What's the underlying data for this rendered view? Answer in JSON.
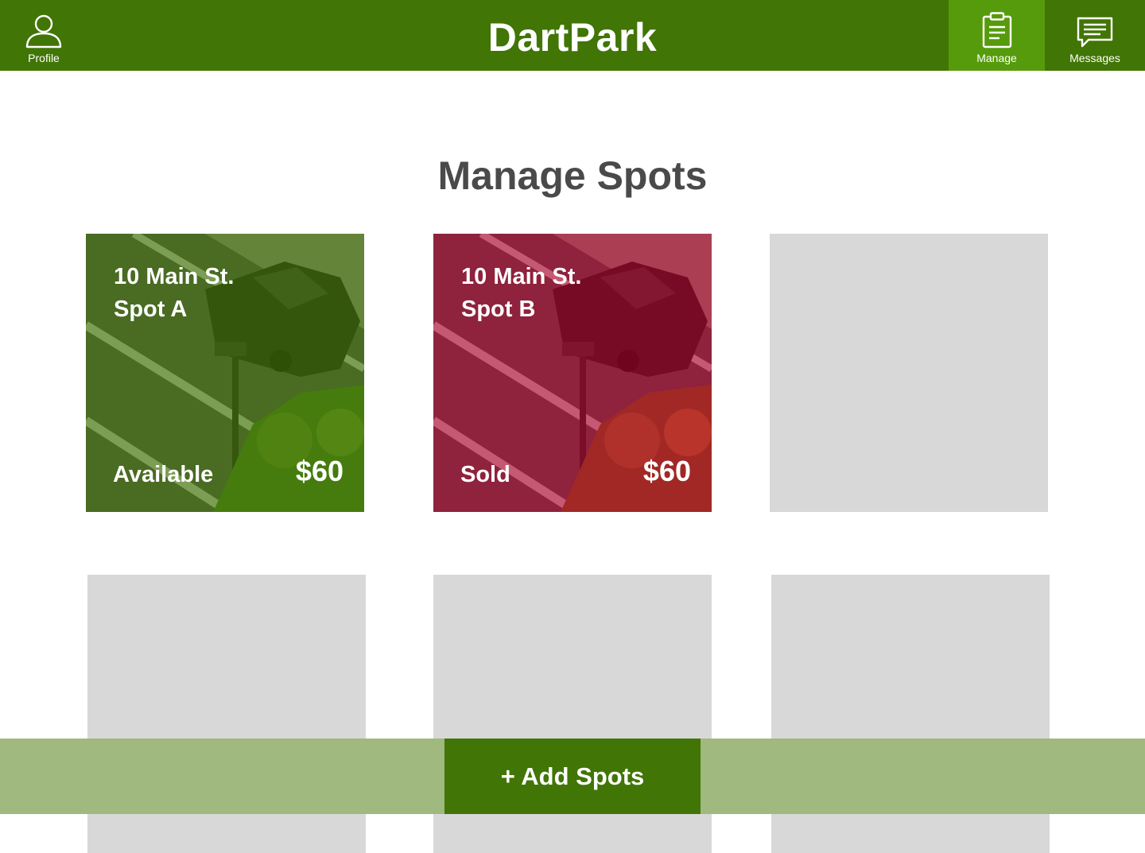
{
  "header": {
    "app_title": "DartPark",
    "nav": {
      "profile_label": "Profile",
      "manage_label": "Manage",
      "messages_label": "Messages"
    },
    "icons": {
      "profile": "user-icon",
      "manage": "clipboard-icon",
      "messages": "chat-icon"
    },
    "active_tab": "Manage"
  },
  "main": {
    "title": "Manage Spots",
    "spots": [
      {
        "address_line1": "10 Main St.",
        "address_line2": "Spot A",
        "status": "Available",
        "price": "$60",
        "tint": "#417505"
      },
      {
        "address_line1": "10 Main St.",
        "address_line2": "Spot B",
        "status": "Sold",
        "price": "$60",
        "tint": "#B0002A"
      }
    ],
    "empty_slots": 4
  },
  "footer": {
    "add_button_label": "+ Add Spots"
  },
  "colors": {
    "primary": "#417505",
    "primary_active": "#569B0B",
    "footer_bg": "#9FB97F",
    "placeholder": "#D8D8D8",
    "title_text": "#4A4A4A"
  }
}
